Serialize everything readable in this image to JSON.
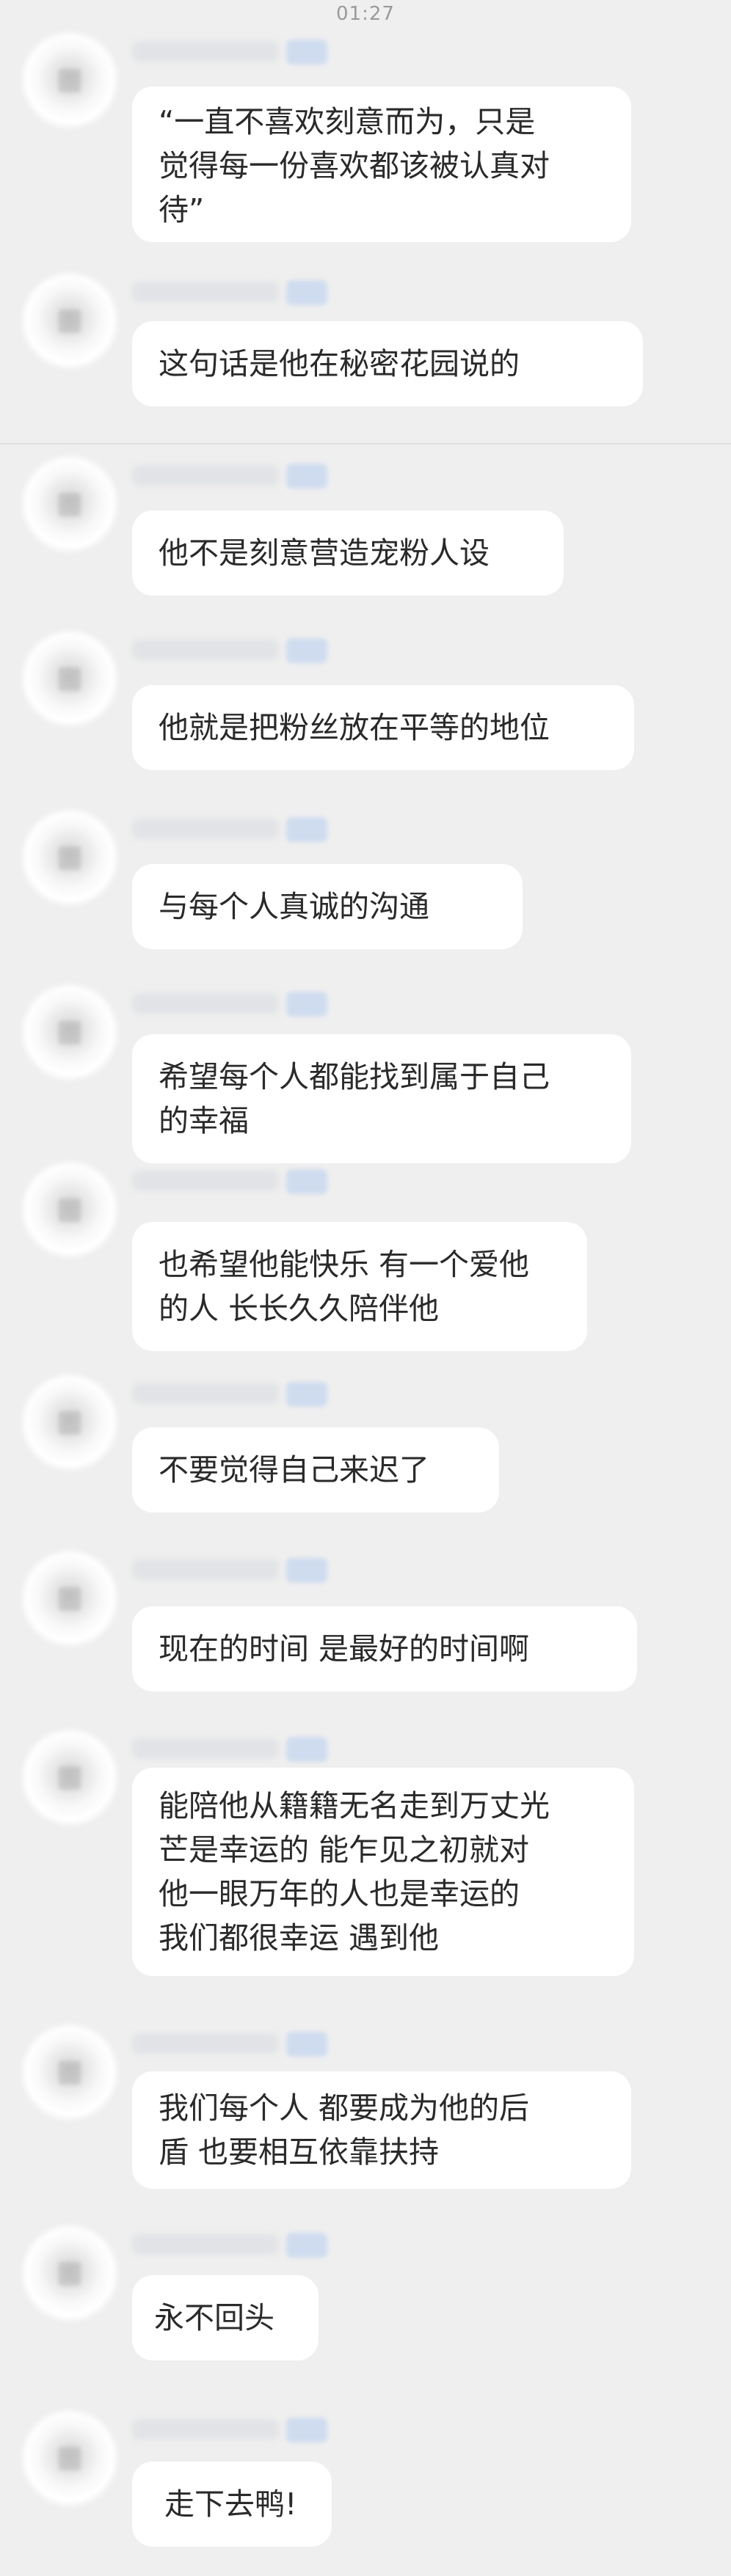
{
  "status": {
    "time": "01:27"
  },
  "messages": [
    {
      "lines": [
        "“一直不喜欢刻意而为，只是",
        "觉得每一份喜欢都该被认真对",
        "待”"
      ]
    },
    {
      "lines": [
        "这句话是他在秘密花园说的"
      ]
    },
    {
      "lines": [
        "他不是刻意营造宠粉人设"
      ]
    },
    {
      "lines": [
        "他就是把粉丝放在平等的地位"
      ]
    },
    {
      "lines": [
        "与每个人真诚的沟通"
      ]
    },
    {
      "lines": [
        "希望每个人都能找到属于自己",
        "的幸福"
      ]
    },
    {
      "lines": [
        "也希望他能快乐 有一个爱他",
        "的人 长长久久陪伴他"
      ]
    },
    {
      "lines": [
        "不要觉得自己来迟了"
      ]
    },
    {
      "lines": [
        "现在的时间 是最好的时间啊"
      ]
    },
    {
      "lines": [
        "能陪他从籍籍无名走到万丈光",
        "芒是幸运的 能乍见之初就对",
        "他一眼万年的人也是幸运的",
        "我们都很幸运 遇到他"
      ]
    },
    {
      "lines": [
        "我们每个人 都要成为他的后",
        "盾 也要相互依靠扶持"
      ]
    },
    {
      "lines": [
        "永不回头"
      ]
    },
    {
      "lines": [
        "走下去鸭!"
      ]
    }
  ]
}
